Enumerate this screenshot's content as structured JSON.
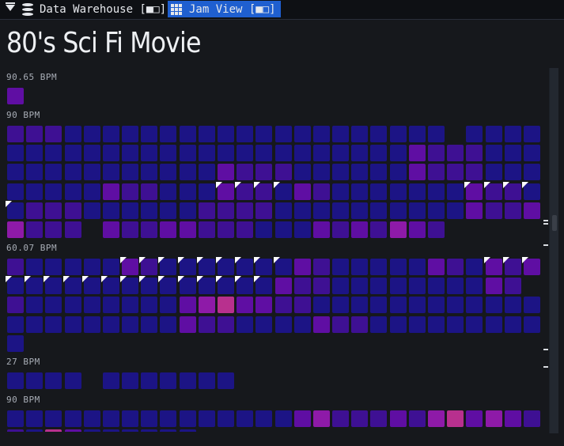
{
  "window": {
    "tabs": [
      {
        "label": "Data Warehouse [■□]",
        "icon": "database-icon",
        "active": false
      },
      {
        "label": "Jam View [■□]",
        "icon": "grid-icon",
        "active": true
      }
    ],
    "accent": "#1f5fd0"
  },
  "page": {
    "title": "80's Sci Fi Movie"
  },
  "groups": [
    {
      "bpm_label": "90.65 BPM",
      "rows": [
        [
          "P"
        ]
      ]
    },
    {
      "bpm_label": "90 BPM",
      "rows": [
        [
          "V",
          "V",
          "V",
          "B",
          "B",
          "B",
          "B",
          "B",
          "B",
          "B",
          "B",
          "B",
          "B",
          "B",
          "B",
          "B",
          "B",
          "B",
          "B",
          "B",
          "B",
          "B",
          "B",
          "_",
          "B",
          "B",
          "B",
          "B"
        ],
        [
          "B",
          "B",
          "B",
          "B",
          "B",
          "B",
          "B",
          "B",
          "B",
          "B",
          "B",
          "B",
          "B",
          "B",
          "B",
          "B",
          "B",
          "B",
          "B",
          "B",
          "B",
          "P",
          "V",
          "V",
          "V",
          "B",
          "B",
          "B"
        ],
        [
          "B",
          "B",
          "B",
          "B",
          "B",
          "B",
          "B",
          "B",
          "B",
          "B",
          "B",
          "P",
          "V",
          "V",
          "V",
          "B",
          "B",
          "B",
          "B",
          "B",
          "B",
          "P",
          "V",
          "V",
          "V",
          "B",
          "B",
          "B"
        ],
        [
          "B",
          "B",
          "B",
          "B",
          "B",
          "P",
          "V",
          "V",
          "B",
          "B",
          "B",
          "fP",
          "fV",
          "fV",
          "fB",
          "P",
          "V",
          "B",
          "B",
          "B",
          "B",
          "B",
          "B",
          "B",
          "fP",
          "fV",
          "fV",
          "fB"
        ],
        [
          "fB",
          "V",
          "V",
          "V",
          "B",
          "B",
          "B",
          "B",
          "B",
          "B",
          "V",
          "V",
          "V",
          "V",
          "B",
          "B",
          "B",
          "B",
          "B",
          "B",
          "B",
          "B",
          "B",
          "B",
          "P",
          "V",
          "V",
          "P"
        ],
        [
          "M",
          "V",
          "V",
          "V",
          "_",
          "P",
          "V",
          "V",
          "P",
          "P",
          "V",
          "V",
          "V",
          "B",
          "B",
          "B",
          "P",
          "V",
          "P",
          "V",
          "M",
          "P",
          "V"
        ]
      ]
    },
    {
      "bpm_label": "60.07 BPM",
      "rows": [
        [
          "V",
          "B",
          "B",
          "B",
          "B",
          "B",
          "fP",
          "fV",
          "fB",
          "fB",
          "fB",
          "fB",
          "fB",
          "fB",
          "fB",
          "P",
          "V",
          "B",
          "B",
          "B",
          "B",
          "B",
          "P",
          "V",
          "B",
          "fP",
          "fV",
          "fP"
        ],
        [
          "fB",
          "fB",
          "fB",
          "fB",
          "fB",
          "fB",
          "fB",
          "fB",
          "fB",
          "fB",
          "fB",
          "fB",
          "fB",
          "fB",
          "P",
          "V",
          "V",
          "B",
          "B",
          "B",
          "B",
          "B",
          "B",
          "B",
          "B",
          "P",
          "V"
        ],
        [
          "V",
          "B",
          "B",
          "B",
          "B",
          "B",
          "B",
          "B",
          "B",
          "P",
          "M",
          "R",
          "P",
          "P",
          "V",
          "V",
          "B",
          "B",
          "B",
          "B",
          "B",
          "B",
          "B",
          "B",
          "B",
          "B",
          "B",
          "B"
        ],
        [
          "B",
          "B",
          "B",
          "B",
          "B",
          "B",
          "B",
          "B",
          "B",
          "P",
          "V",
          "V",
          "B",
          "B",
          "B",
          "B",
          "P",
          "V",
          "V",
          "B",
          "B",
          "B",
          "B",
          "B",
          "B",
          "B",
          "B",
          "B"
        ],
        [
          "B"
        ]
      ]
    },
    {
      "bpm_label": "27 BPM",
      "rows": [
        [
          "B",
          "B",
          "B",
          "B",
          "_",
          "B",
          "B",
          "B",
          "B",
          "B",
          "B",
          "B"
        ]
      ]
    },
    {
      "bpm_label": "90 BPM",
      "rows": [
        [
          "B",
          "B",
          "B",
          "B",
          "B",
          "B",
          "B",
          "B",
          "B",
          "B",
          "B",
          "B",
          "B",
          "B",
          "B",
          "P",
          "M",
          "V",
          "V",
          "V",
          "P",
          "V",
          "M",
          "R",
          "P",
          "M",
          "P",
          "V"
        ],
        [
          "V",
          "B",
          "R",
          "P",
          "B",
          "B",
          "B",
          "B",
          "B",
          "B"
        ]
      ]
    }
  ],
  "colors": {
    "B": "#1c1485",
    "V": "#3e1093",
    "P": "#5f0ea3",
    "M": "#8e1aa8",
    "R": "#b8308e"
  },
  "icons": [
    "menu-caret-icon",
    "database-icon",
    "grid-icon"
  ]
}
